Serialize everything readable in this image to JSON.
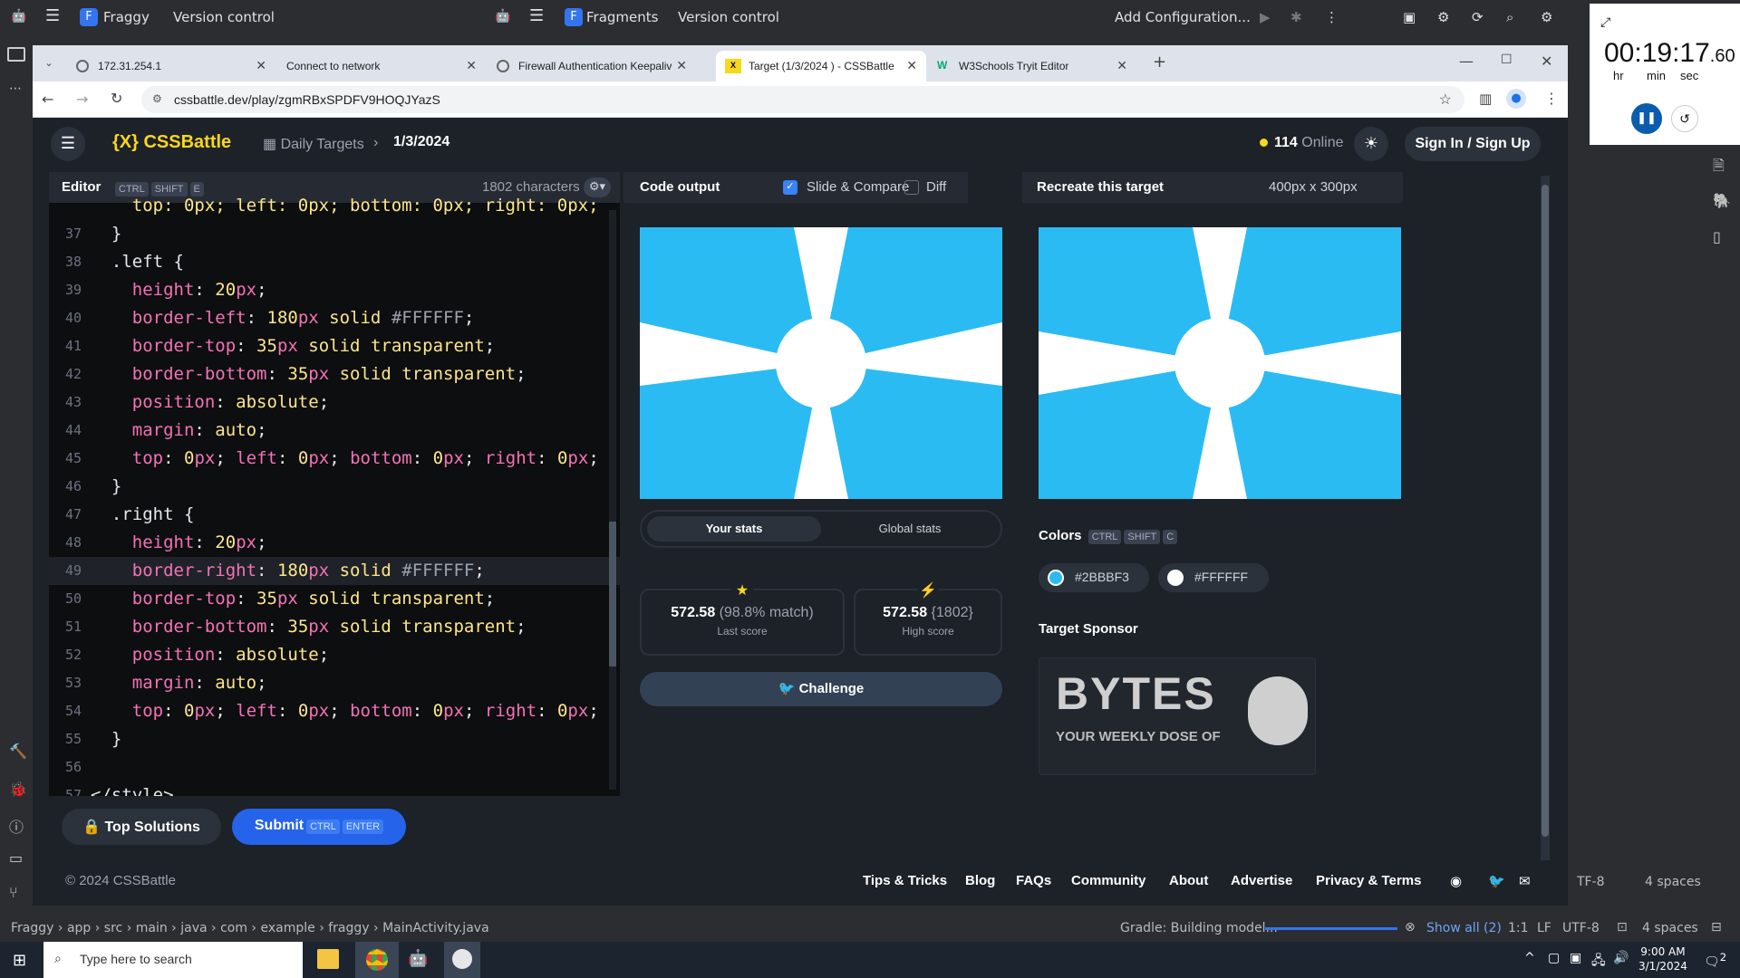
{
  "ide": {
    "project": "Fraggy",
    "vc_left": "Version control",
    "project2": "Fragments",
    "vc_right": "Version control",
    "add_config": "Add Configuration...",
    "breadcrumb": [
      "Fraggy",
      "app",
      "src",
      "main",
      "java",
      "com",
      "example",
      "fraggy",
      "MainActivity.java"
    ],
    "gradle": "Gradle: Building model...",
    "show_all": "Show all (2)",
    "pos": "1:1",
    "lf": "LF",
    "enc": "UTF-8",
    "spaces": "4 spaces",
    "enc2": "TF-8",
    "spaces2": "4 spaces"
  },
  "timer": {
    "time": "00:19:17",
    "frac": ".60",
    "hr": "hr",
    "min": "min",
    "sec": "sec"
  },
  "browser": {
    "tabs": [
      {
        "label": "172.31.254.1"
      },
      {
        "label": "Connect to network"
      },
      {
        "label": "Firewall Authentication Keepalive"
      },
      {
        "label": "Target (1/3/2024 ) - CSSBattle"
      },
      {
        "label": "W3Schools Tryit Editor"
      }
    ],
    "url": "cssbattle.dev/play/zgmRBxSPDFV9HOQJYazS"
  },
  "site": {
    "logo": "{X} CSSBattle",
    "crumb1": "Daily Targets",
    "crumb2": "1/3/2024",
    "online_count": "114",
    "online_label": "Online",
    "signin": "Sign In / Sign Up",
    "editor_label": "Editor",
    "chars": "1802 characters",
    "output_label": "Code output",
    "slide_compare": "Slide & Compare",
    "diff": "Diff",
    "target_label": "Recreate this target",
    "size": "400px x 300px",
    "your_stats": "Your stats",
    "global_stats": "Global stats",
    "last_score": "572.58",
    "last_match": "(98.8% match)",
    "last_label": "Last score",
    "high_score": "572.58",
    "high_chars": "{1802}",
    "high_label": "High score",
    "challenge": "Challenge",
    "colors_label": "Colors",
    "color1": "#2BBBF3",
    "color2": "#FFFFFF",
    "sponsor_label": "Target Sponsor",
    "sponsor_word": "BYTES",
    "sponsor_tag": "YOUR WEEKLY DOSE OF",
    "top_solutions": "Top Solutions",
    "submit": "Submit",
    "copyright": "© 2024 CSSBattle",
    "footer": [
      "Tips & Tricks",
      "Blog",
      "FAQs",
      "Community",
      "About",
      "Advertise",
      "Privacy & Terms"
    ]
  },
  "code": [
    {
      "n": "37",
      "t": "  }"
    },
    {
      "n": "38",
      "t": "  .left {"
    },
    {
      "n": "39",
      "t": "    height: 20px;"
    },
    {
      "n": "40",
      "t": "    border-left: 180px solid #FFFFFF;"
    },
    {
      "n": "41",
      "t": "    border-top: 35px solid transparent;"
    },
    {
      "n": "42",
      "t": "    border-bottom: 35px solid transparent;"
    },
    {
      "n": "43",
      "t": "    position: absolute;"
    },
    {
      "n": "44",
      "t": "    margin: auto;"
    },
    {
      "n": "45",
      "t": "    top: 0px; left: 0px; bottom: 0px; right: 0px;"
    },
    {
      "n": "46",
      "t": "  }"
    },
    {
      "n": "47",
      "t": "  .right {"
    },
    {
      "n": "48",
      "t": "    height: 20px;"
    },
    {
      "n": "49",
      "t": "    border-right: 180px solid #FFFFFF;"
    },
    {
      "n": "50",
      "t": "    border-top: 35px solid transparent;"
    },
    {
      "n": "51",
      "t": "    border-bottom: 35px solid transparent;"
    },
    {
      "n": "52",
      "t": "    position: absolute;"
    },
    {
      "n": "53",
      "t": "    margin: auto;"
    },
    {
      "n": "54",
      "t": "    top: 0px; left: 0px; bottom: 0px; right: 0px;"
    },
    {
      "n": "55",
      "t": "  }"
    },
    {
      "n": "56",
      "t": ""
    },
    {
      "n": "57",
      "t": "</style>"
    }
  ],
  "partial_line": "    top: 0px; left: 0px; bottom: 0px; right: 0px;",
  "kbd": {
    "ctrl": "CTRL",
    "shift": "SHIFT",
    "e": "E",
    "c": "C",
    "enter": "ENTER"
  },
  "taskbar": {
    "search": "Type here to search",
    "time": "9:00 AM",
    "date": "3/1/2024",
    "notif": "2"
  },
  "colors": {
    "target_bg": "#2BBBF3",
    "accent": "#f9d71c",
    "submit": "#2563eb"
  }
}
